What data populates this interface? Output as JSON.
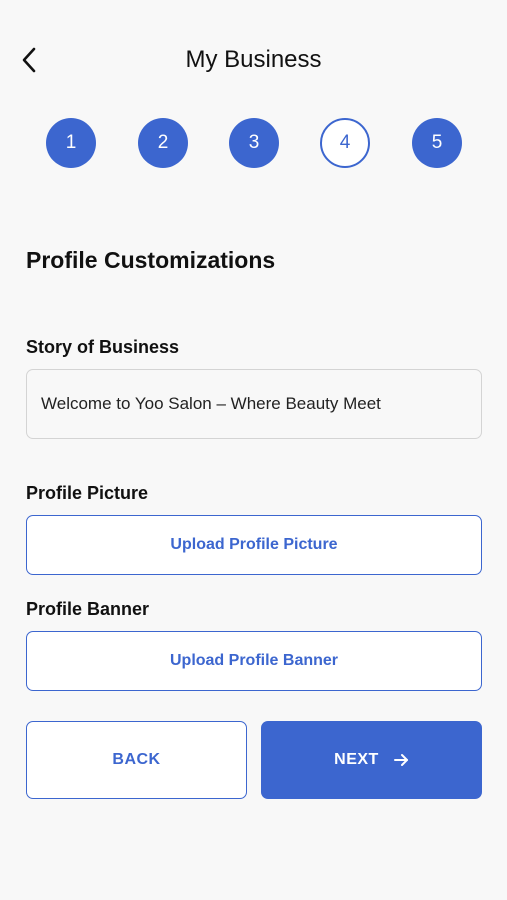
{
  "header": {
    "title": "My Business",
    "back_icon": "chevron-left-icon"
  },
  "stepper": {
    "current": 4,
    "steps": [
      {
        "label": "1",
        "state": "completed"
      },
      {
        "label": "2",
        "state": "completed"
      },
      {
        "label": "3",
        "state": "completed"
      },
      {
        "label": "4",
        "state": "current"
      },
      {
        "label": "5",
        "state": "completed"
      }
    ]
  },
  "section": {
    "title": "Profile Customizations"
  },
  "story": {
    "label": "Story of Business",
    "value": "Welcome to Yoo Salon – Where Beauty Meet"
  },
  "profile_picture": {
    "label": "Profile Picture",
    "button_label": "Upload Profile Picture"
  },
  "profile_banner": {
    "label": "Profile Banner",
    "button_label": "Upload Profile Banner"
  },
  "actions": {
    "back_label": "BACK",
    "next_label": "NEXT",
    "next_icon": "arrow-right-icon"
  },
  "colors": {
    "accent": "#3c66cf",
    "background": "#f8f8f8",
    "text": "#111111"
  }
}
